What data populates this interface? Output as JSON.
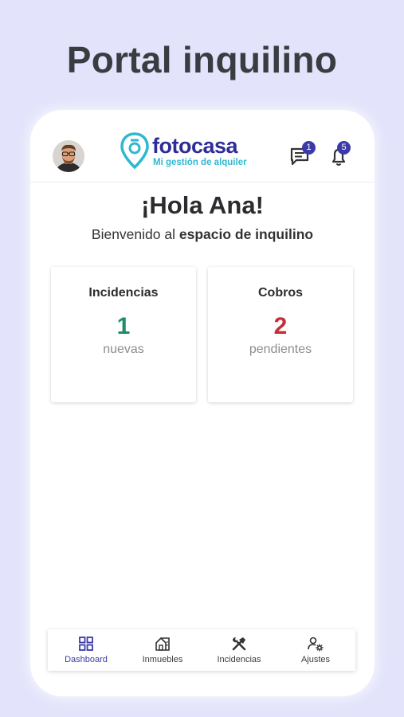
{
  "promo": {
    "title": "Portal inquilino"
  },
  "header": {
    "brand": "fotocasa",
    "tagline": "Mi gestión de alquiler",
    "messages_badge": "1",
    "notifications_badge": "5"
  },
  "welcome": {
    "greeting": "¡Hola Ana!",
    "prefix": "Bienvenido al ",
    "space": "espacio de inquilino"
  },
  "cards": [
    {
      "title": "Incidencias",
      "value": "1",
      "subtitle": "nuevas",
      "color": "#1a8f6a"
    },
    {
      "title": "Cobros",
      "value": "2",
      "subtitle": "pendientes",
      "color": "#c62f38"
    }
  ],
  "nav": {
    "active": "Dashboard",
    "items": [
      {
        "label": "Dashboard",
        "icon": "dashboard-icon"
      },
      {
        "label": "Inmuebles",
        "icon": "house-icon"
      },
      {
        "label": "Incidencias",
        "icon": "tools-icon"
      },
      {
        "label": "Ajustes",
        "icon": "user-settings-icon"
      }
    ]
  },
  "colors": {
    "accent": "#3b3aa8",
    "brand_blue": "#2e2d97",
    "brand_teal": "#2fb8d0",
    "background": "#e3e4fb"
  }
}
